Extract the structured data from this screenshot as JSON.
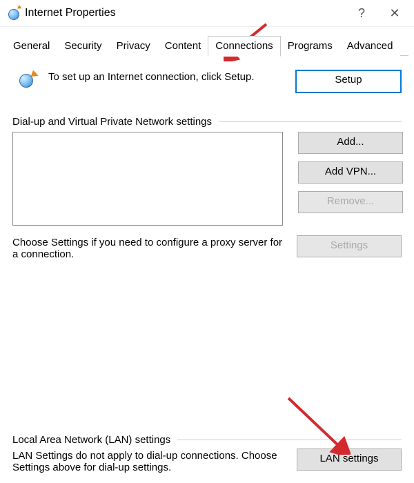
{
  "window": {
    "title": "Internet Properties",
    "help_label": "?",
    "close_label": "✕"
  },
  "tabs": {
    "general": "General",
    "security": "Security",
    "privacy": "Privacy",
    "content": "Content",
    "connections": "Connections",
    "programs": "Programs",
    "advanced": "Advanced",
    "active": "connections"
  },
  "setup": {
    "text": "To set up an Internet connection, click Setup.",
    "button": "Setup"
  },
  "dialup": {
    "group_label": "Dial-up and Virtual Private Network settings",
    "add": "Add...",
    "add_vpn": "Add VPN...",
    "remove": "Remove...",
    "settings": "Settings",
    "proxy_hint": "Choose Settings if you need to configure a proxy server for a connection."
  },
  "lan": {
    "group_label": "Local Area Network (LAN) settings",
    "hint": "LAN Settings do not apply to dial-up connections. Choose Settings above for dial-up settings.",
    "button": "LAN settings"
  },
  "colors": {
    "annotation": "#d4292f"
  }
}
